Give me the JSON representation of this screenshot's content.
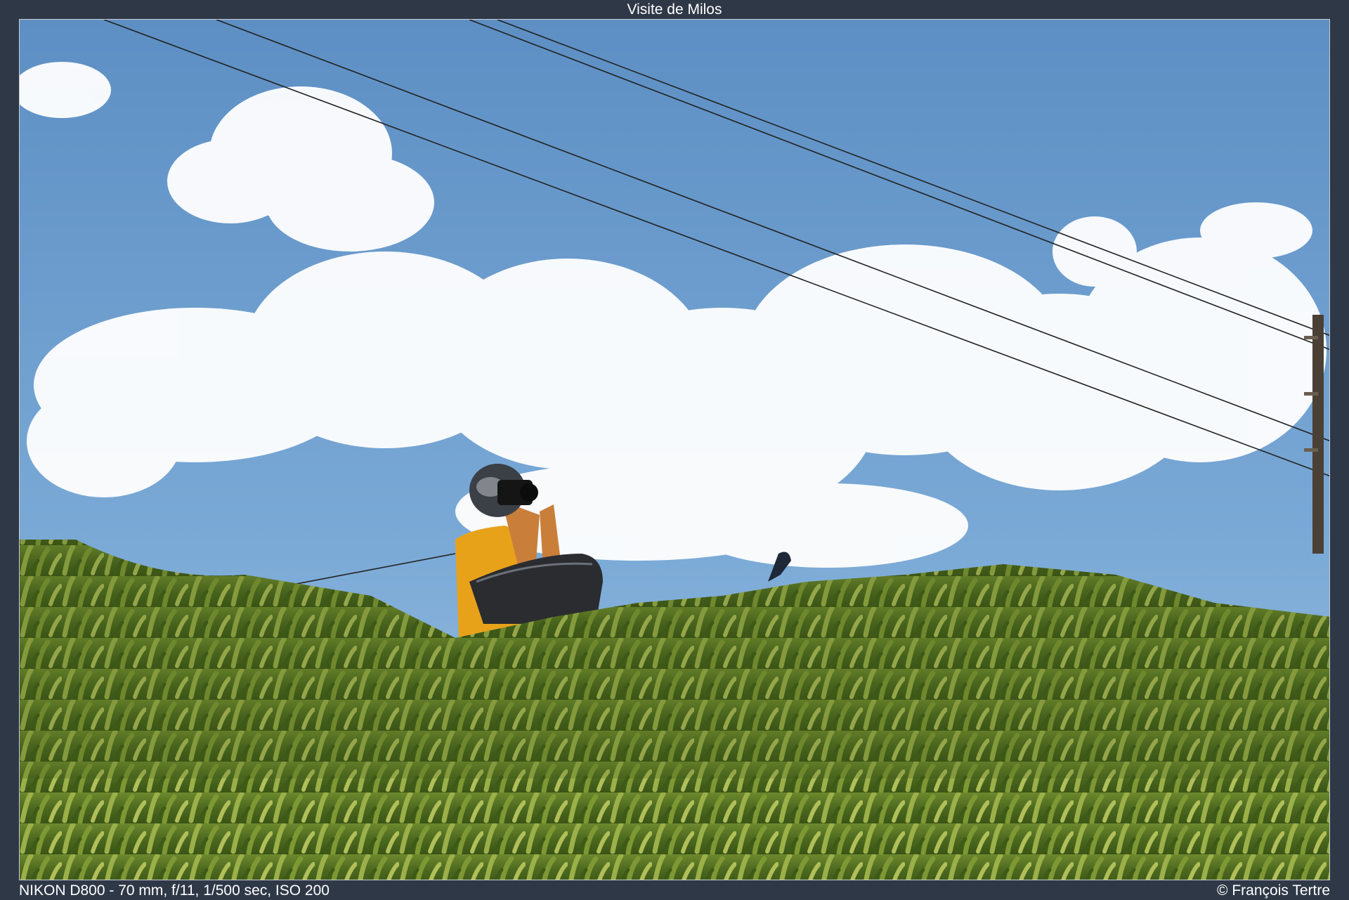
{
  "frame": {
    "title": "Visite de Milos",
    "exif": "NIKON D800 - 70 mm, f/11, 1/500 sec, ISO 200",
    "credit": "© François Tertre"
  },
  "colors": {
    "background": "#2f3847",
    "sky": "#6f9dcc",
    "cloud": "#ffffff",
    "foliage": "#5f7d2a",
    "shirt": "#e8a21a",
    "helmet": "#3b3f46"
  }
}
